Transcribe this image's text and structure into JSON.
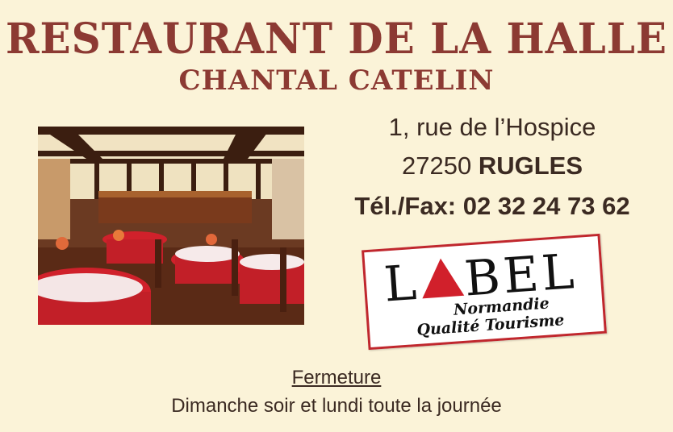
{
  "header": {
    "title": "RESTAURANT DE LA HALLE",
    "subtitle": "CHANTAL CATELIN"
  },
  "address": {
    "street": "1, rue de l’Hospice",
    "postcode": "27250",
    "city": "RUGLES",
    "phone": "Tél./Fax: 02 32 24 73 62"
  },
  "label": {
    "word_start": "L",
    "word_end": "BEL",
    "line1": "Normandie",
    "line2": "Qualité Tourisme",
    "accent_color": "#d1202b"
  },
  "closure": {
    "title": "Fermeture",
    "text": "Dimanche soir et lundi toute la journée"
  },
  "colors": {
    "background": "#fbf3d8",
    "title": "#8c3a33",
    "text": "#3b2a22"
  }
}
